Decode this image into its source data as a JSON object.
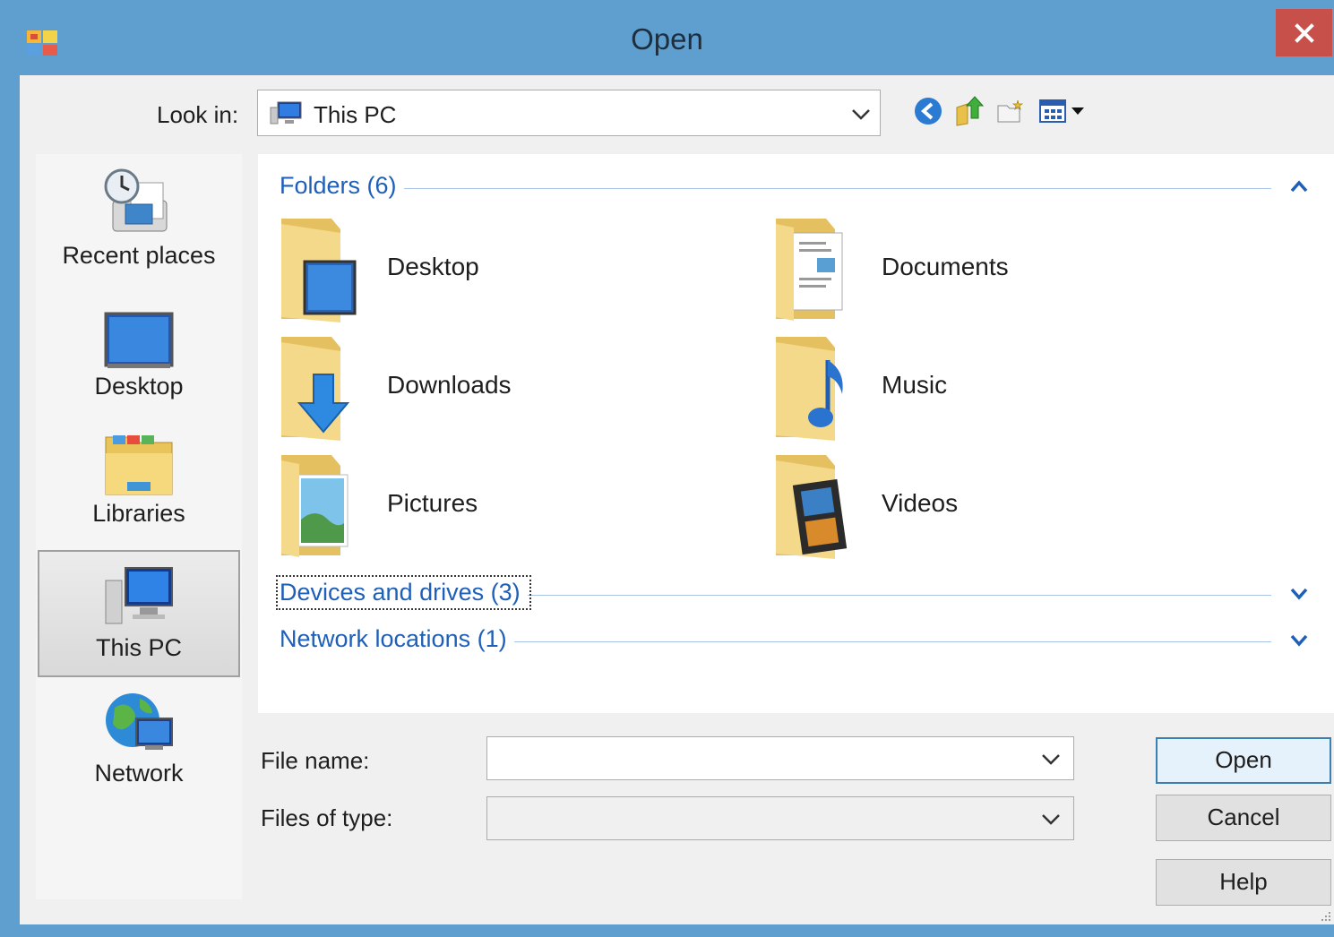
{
  "window": {
    "title": "Open",
    "close_label": "✕"
  },
  "lookin": {
    "label": "Look in:",
    "value": "This PC"
  },
  "toolbar": {
    "icons": [
      "back-icon",
      "up-folder-icon",
      "new-folder-icon",
      "view-menu-icon"
    ]
  },
  "places": [
    {
      "label": "Recent places",
      "icon": "recent-places-icon"
    },
    {
      "label": "Desktop",
      "icon": "desktop-icon"
    },
    {
      "label": "Libraries",
      "icon": "libraries-icon"
    },
    {
      "label": "This PC",
      "icon": "this-pc-icon",
      "selected": true
    },
    {
      "label": "Network",
      "icon": "network-icon"
    }
  ],
  "groups": {
    "folders": {
      "label": "Folders (6)",
      "expanded": true
    },
    "devices": {
      "label": "Devices and drives (3)",
      "expanded": false
    },
    "network": {
      "label": "Network locations (1)",
      "expanded": false
    }
  },
  "folders": [
    {
      "name": "Desktop",
      "icon": "desktop-folder-icon"
    },
    {
      "name": "Documents",
      "icon": "documents-folder-icon"
    },
    {
      "name": "Downloads",
      "icon": "downloads-folder-icon"
    },
    {
      "name": "Music",
      "icon": "music-folder-icon"
    },
    {
      "name": "Pictures",
      "icon": "pictures-folder-icon"
    },
    {
      "name": "Videos",
      "icon": "videos-folder-icon"
    }
  ],
  "form": {
    "file_name_label": "File name:",
    "file_name_value": "",
    "file_type_label": "Files of type:",
    "file_type_value": ""
  },
  "buttons": {
    "open": "Open",
    "cancel": "Cancel",
    "help": "Help"
  },
  "colors": {
    "titlebar": "#5e9fd0",
    "close": "#c7504a",
    "link": "#1e5fb8",
    "folder": "#f2d37a"
  }
}
